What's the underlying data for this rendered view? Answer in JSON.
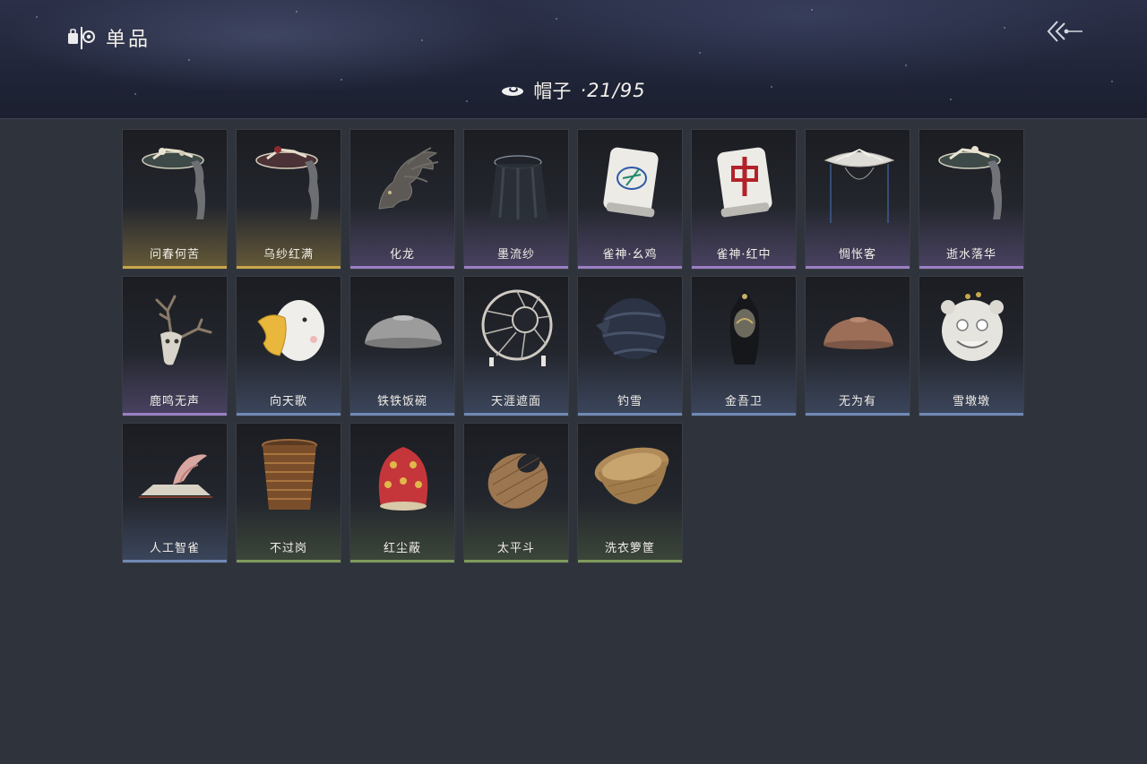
{
  "header": {
    "title": "单品",
    "category": {
      "title": "帽子",
      "count": "·21/95"
    }
  },
  "items": [
    {
      "name": "问春何苦",
      "icon": "veiled-bamboo-hat-icon",
      "rarity": "gold"
    },
    {
      "name": "乌纱红满",
      "icon": "red-veiled-hat-icon",
      "rarity": "gold"
    },
    {
      "name": "化龙",
      "icon": "dragon-head-icon",
      "rarity": "purple"
    },
    {
      "name": "墨流纱",
      "icon": "black-gauze-hat-icon",
      "rarity": "purple"
    },
    {
      "name": "雀神·幺鸡",
      "icon": "mahjong-one-bamboo-icon",
      "rarity": "purple"
    },
    {
      "name": "雀神·红中",
      "icon": "mahjong-red-dragon-icon",
      "rarity": "purple"
    },
    {
      "name": "惆怅客",
      "icon": "white-curtain-hat-icon",
      "rarity": "purple"
    },
    {
      "name": "逝水落华",
      "icon": "veiled-flower-hat-icon",
      "rarity": "purple"
    },
    {
      "name": "鹿鸣无声",
      "icon": "deer-skull-icon",
      "rarity": "purple"
    },
    {
      "name": "向天歌",
      "icon": "goose-hood-icon",
      "rarity": "blue"
    },
    {
      "name": "铁铁饭碗",
      "icon": "iron-bowl-icon",
      "rarity": "blue"
    },
    {
      "name": "天涯遮面",
      "icon": "bamboo-frame-hat-icon",
      "rarity": "blue"
    },
    {
      "name": "钓雪",
      "icon": "dark-wrapped-hat-icon",
      "rarity": "blue"
    },
    {
      "name": "金吾卫",
      "icon": "guard-helmet-icon",
      "rarity": "blue"
    },
    {
      "name": "无为有",
      "icon": "clay-bowl-icon",
      "rarity": "blue"
    },
    {
      "name": "雪墩墩",
      "icon": "lion-mask-icon",
      "rarity": "blue"
    },
    {
      "name": "人工智雀",
      "icon": "bird-hat-icon",
      "rarity": "blue"
    },
    {
      "name": "不过岗",
      "icon": "bowl-stack-icon",
      "rarity": "green"
    },
    {
      "name": "红尘蔽",
      "icon": "red-lantern-hood-icon",
      "rarity": "green"
    },
    {
      "name": "太平斗",
      "icon": "woven-basket-hat-icon",
      "rarity": "green"
    },
    {
      "name": "洗衣箩筐",
      "icon": "laundry-basket-icon",
      "rarity": "green"
    }
  ]
}
